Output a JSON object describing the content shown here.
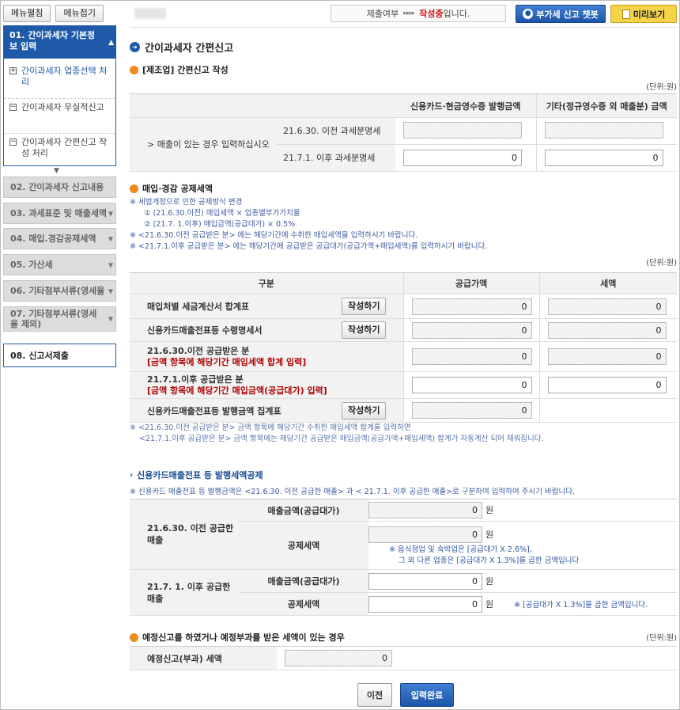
{
  "sidebar": {
    "menu_edit": "메뉴펼침",
    "menu_collapse": "메뉴접기",
    "step1": "01. 간이과세자 기본정보 입력",
    "subs": [
      "간이과세자 업종선택 처리",
      "간이과세자 무실적신고",
      "간이과세자 간편신고 작성 처리"
    ],
    "steps": [
      "02. 간이과세자 신고내용",
      "03. 과세표준 및 매출세액",
      "04. 매입.경감공제세액",
      "05. 가산세",
      "06. 기타첨부서류(영세율",
      "07. 기타첨부서류(영세율 제외)",
      "08. 신고서제출"
    ]
  },
  "topbar": {
    "status_label": "제출여부",
    "status_arrows": "▸▸▸▸",
    "status_value": "작성중",
    "status_suffix": "입니다.",
    "chatbot": "부가세 신고 챗봇",
    "preview": "미리보기"
  },
  "page_title": "간이과세자 간편신고",
  "section1": {
    "title": "[제조업] 간편신고 작성",
    "unit": "(단위:원)",
    "col1": "신용카드·현금영수증 발행금액",
    "col2": "기타(정규영수증 외 매출분) 금액",
    "row_label": "> 매출이 있는 경우 입력하십시오",
    "rows": [
      {
        "label": "21.6.30. 이전 과세분명세",
        "v1": "",
        "v2": ""
      },
      {
        "label": "21.7.1. 이후 과세분명세",
        "v1": "0",
        "v2": "0"
      }
    ]
  },
  "section2": {
    "title": "매입·경감 공제세액",
    "notes": [
      "※ 세법개정으로 인한 공제방식 변경",
      "① (21.6.30.이전) 매입세액 × 업종별부가가치율",
      "② (21.7. 1.이후) 매입금액(공급대가) × 0.5%",
      "※ <21.6.30.이전 공급받은 분> 에는 해당기간에 수취한 매입세액을 입력하시기 바랍니다.",
      "※ <21.7.1.이후 공급받은 분> 에는 해당기간에 공급받은 공급대가(공급가액+매입세액)를 입력하시기 바랍니다."
    ],
    "unit": "(단위:원)",
    "head": [
      "구분",
      "공급가액",
      "세액"
    ],
    "write_btn": "작성하기",
    "rows": [
      {
        "label": "매입처별 세금계산서 합계표",
        "sub": "",
        "v1": "0",
        "v2": "0"
      },
      {
        "label": "신용카드매출전표등 수령명세서",
        "sub": "",
        "v1": "0",
        "v2": "0"
      },
      {
        "label": "21.6.30.이전 공급받은 분",
        "sub": "[금액 항목에 해당기간 매입세액 합계 입력]",
        "v1": "0",
        "v2": "0"
      },
      {
        "label": "21.7.1.이후 공급받은 분",
        "sub": "[금액 항목에 해당기간 매입금액(공급대가) 입력]",
        "v1": "0",
        "v2": "0"
      },
      {
        "label": "신용카드매출전표등 발행금액 집계표",
        "sub": "",
        "v1": "0",
        "v2": ""
      }
    ],
    "foot_notes": [
      "※ <21.6.30.이전 공급받은 분> 금액 항목에 해당기간 수취한 매입세액 합계를 입력하면",
      "<21.7.1.이후 공급받은 분> 금액 항목에는 해당기간 공급받은 매입금액(공급가액+매입세액) 합계가 자동계산 되어 채워집니다."
    ]
  },
  "section3": {
    "title": "신용카드매출전표 등 발행세액공제",
    "note": "※ 신용카드 매출전표 등 발행금액은 <21.6.30. 이전 공급한 매출> 과 < 21.7.1. 이후 공급한 매출>로 구분하여 입력하여 주시기 바랍니다.",
    "group1": "21.6.30. 이전 공급한 매출",
    "group2": "21.7. 1. 이후 공급한 매출",
    "sales_label": "매출금액(공급대가)",
    "deduct_label": "공제세액",
    "won": "원",
    "g1_sales": "0",
    "g1_deduct": "0",
    "g1_note1": "※ 음식점업 및 숙박업은 [공급대가 X 2.6%],",
    "g1_note2": "그 외 다른 업종은 [공급대가 X 1.3%]를 곱한 금액입니다",
    "g2_sales": "0",
    "g2_deduct": "0",
    "g2_note": "※ [공급대가 X 1.3%]를 곱한 금액입니다."
  },
  "section4": {
    "title": "예정신고를 하였거나 예정부과를 받은 세액이 있는 경우",
    "unit": "(단위:원)",
    "label": "예정신고(부과) 세액",
    "value": "0"
  },
  "buttons": {
    "prev": "이전",
    "done": "입력완료"
  }
}
